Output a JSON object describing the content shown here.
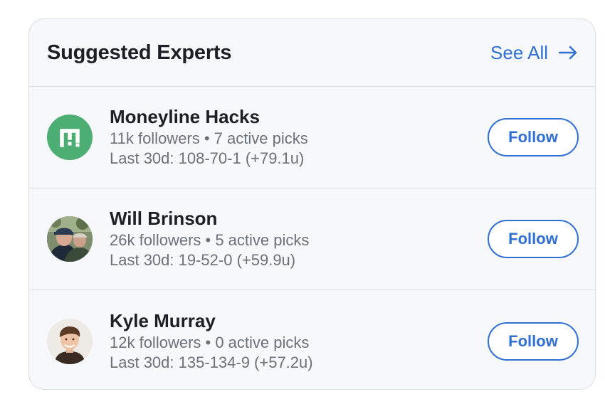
{
  "header": {
    "title": "Suggested Experts",
    "see_all_label": "See All"
  },
  "colors": {
    "accent": "#2f6fd6",
    "brand_green": "#4cae72"
  },
  "experts": [
    {
      "name": "Moneyline Hacks",
      "followers_line": "11k followers • 7 active picks",
      "record_line": "Last 30d: 108-70-1 (+79.1u)",
      "follow_label": "Follow",
      "avatar": "moneyline-logo-icon"
    },
    {
      "name": "Will Brinson",
      "followers_line": "26k followers • 5 active picks",
      "record_line": "Last 30d: 19-52-0 (+59.9u)",
      "follow_label": "Follow",
      "avatar": "user-photo"
    },
    {
      "name": "Kyle Murray",
      "followers_line": "12k followers • 0 active picks",
      "record_line": "Last 30d: 135-134-9 (+57.2u)",
      "follow_label": "Follow",
      "avatar": "user-photo"
    }
  ]
}
